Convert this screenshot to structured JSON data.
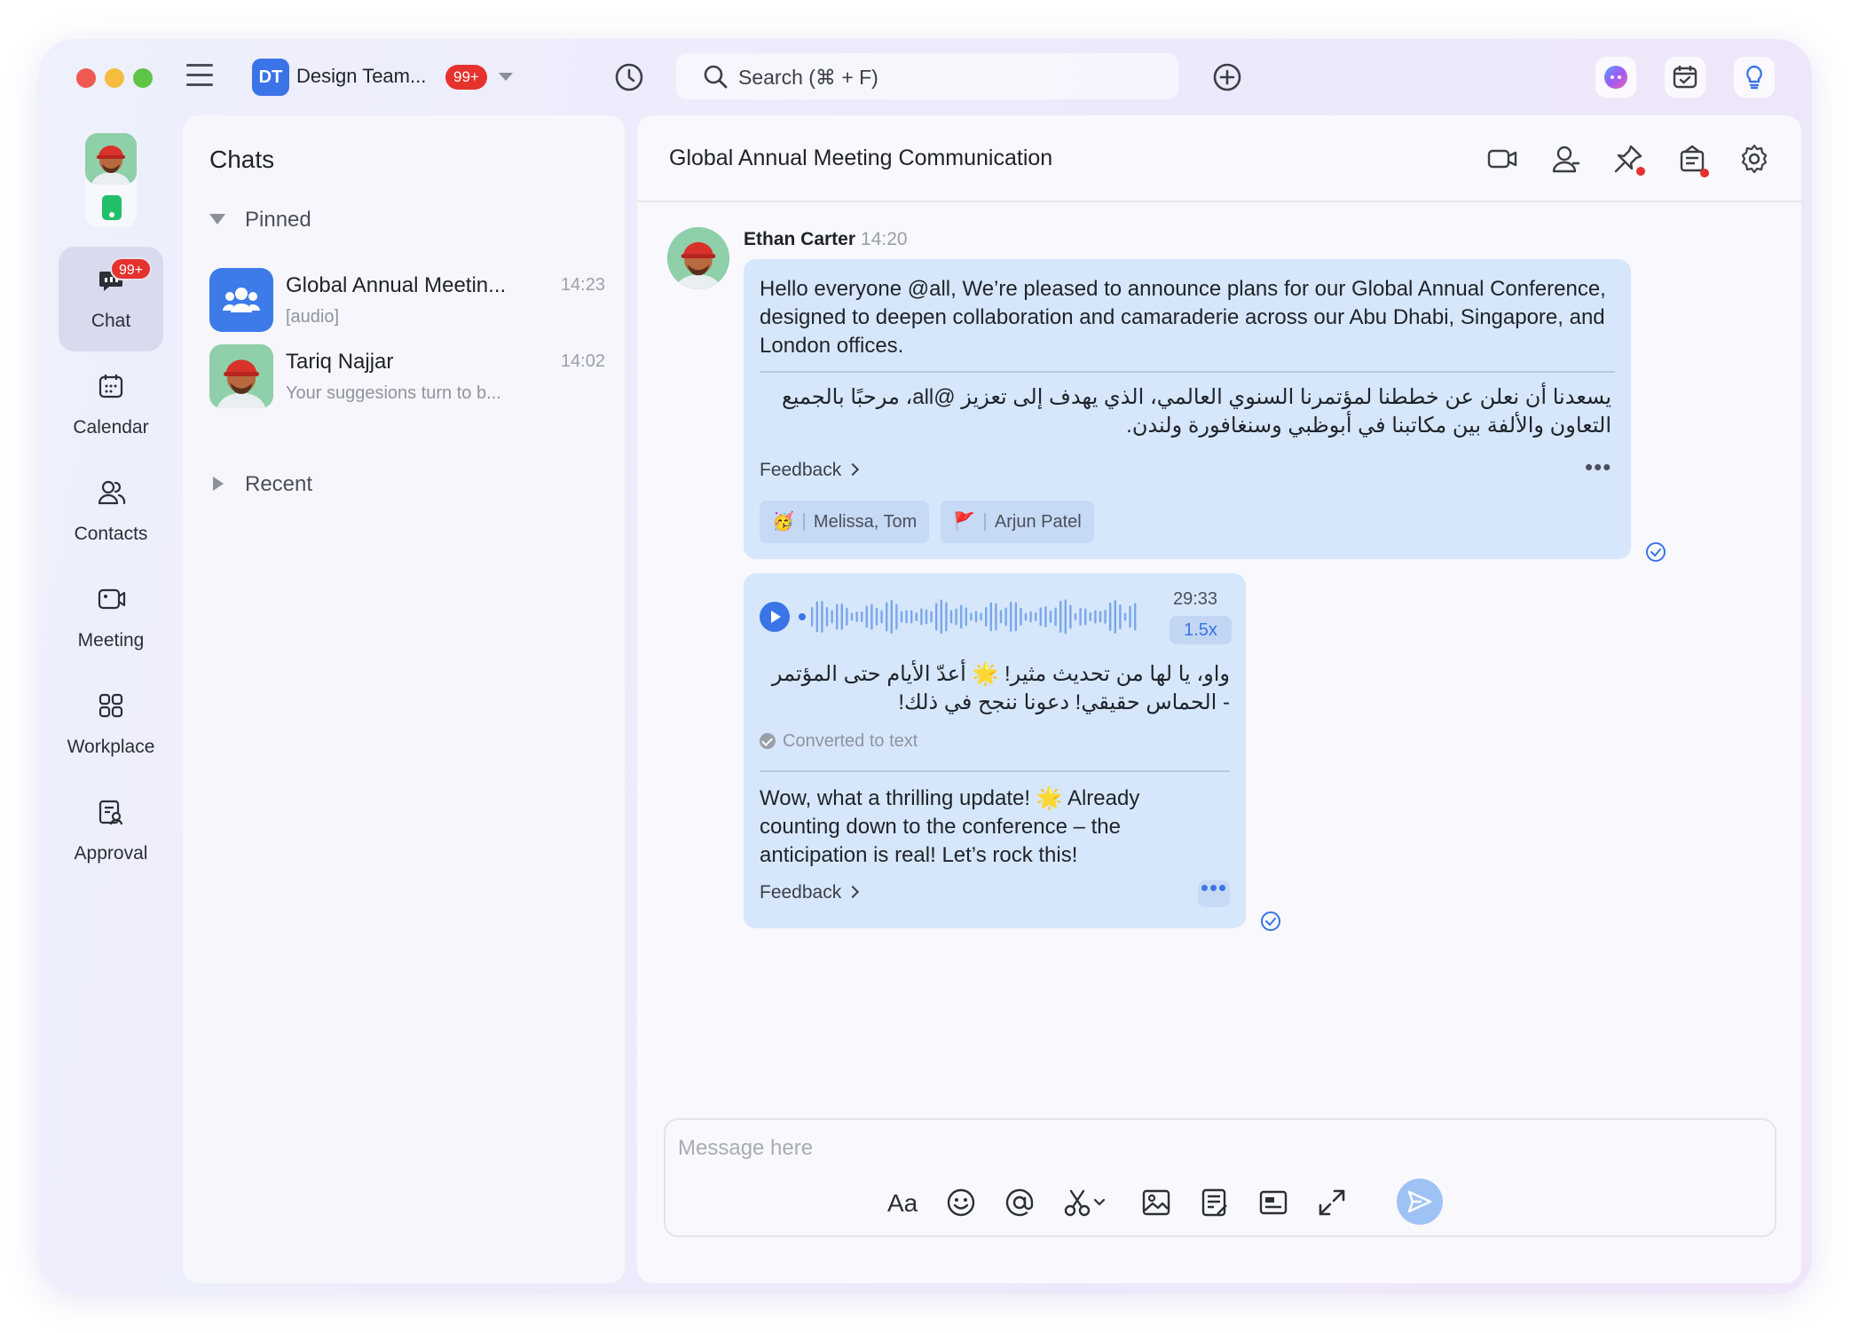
{
  "topbar": {
    "team_initials": "DT",
    "team_name": "Design Team...",
    "team_badge": "99+",
    "search_placeholder": "Search (⌘ + F)"
  },
  "nav": {
    "chat_badge": "99+",
    "items": [
      {
        "label": "Chat",
        "icon": "chat-icon",
        "active": true
      },
      {
        "label": "Calendar",
        "icon": "calendar-icon"
      },
      {
        "label": "Contacts",
        "icon": "contacts-icon"
      },
      {
        "label": "Meeting",
        "icon": "meeting-icon"
      },
      {
        "label": "Workplace",
        "icon": "workplace-icon"
      },
      {
        "label": "Approval",
        "icon": "approval-icon"
      }
    ]
  },
  "chat_list": {
    "title": "Chats",
    "pinned_label": "Pinned",
    "recent_label": "Recent",
    "chats": [
      {
        "name": "Global Annual Meetin...",
        "time": "14:23",
        "preview": "[audio]"
      },
      {
        "name": "Tariq Najjar",
        "time": "14:02",
        "preview": "Your suggesions turn to b..."
      }
    ]
  },
  "conversation": {
    "title": "Global Annual Meeting Communication",
    "message1": {
      "sender": "Ethan Carter",
      "time": "14:20",
      "text_en": "Hello everyone @all, We’re pleased to announce plans for our Global Annual Conference, designed to deepen collaboration and camaraderie across our Abu Dhabi, Singapore, and London offices.",
      "text_ar": "يسعدنا أن نعلن عن خططنا لمؤتمرنا السنوي العالمي، الذي يهدف إلى تعزيز @all، مرحبًا بالجميع التعاون والألفة بين مكاتبنا في أبوظبي وسنغافورة ولندن.",
      "feedback": "Feedback",
      "reactions": [
        {
          "emoji": "🥳",
          "names": "Melissa, Tom"
        },
        {
          "emoji": "🚩",
          "names": "Arjun Patel"
        }
      ]
    },
    "message2": {
      "duration": "29:33",
      "speed": "1.5x",
      "text_ar": "واو، يا لها من تحديث مثير! 🌟 أعدّ الأيام حتى المؤتمر - الحماس حقيقي! دعونا ننجح في ذلك!",
      "converted_label": "Converted to text",
      "text_en": "Wow, what a thrilling update! 🌟 Already counting down to the conference – the anticipation is real! Let’s rock this!",
      "feedback": "Feedback"
    },
    "composer_placeholder": "Message here",
    "format_label": "Aa"
  },
  "colors": {
    "accent": "#3a74e6",
    "bubble": "#d6e7fb",
    "badge": "#e5322d"
  }
}
